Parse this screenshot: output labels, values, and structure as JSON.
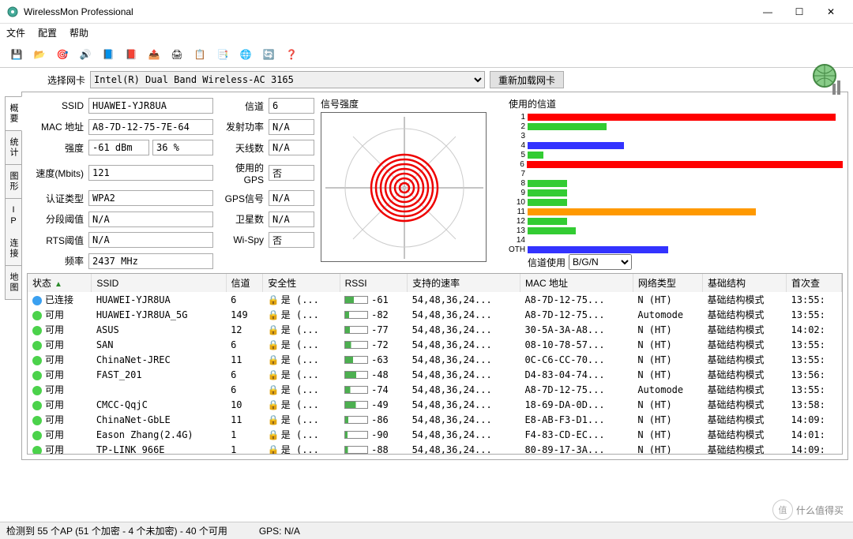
{
  "window": {
    "title": "WirelessMon Professional",
    "min": "—",
    "max": "☐",
    "close": "✕"
  },
  "menu": {
    "file": "文件",
    "config": "配置",
    "help": "帮助"
  },
  "toolbar_icons": [
    {
      "name": "save-icon",
      "glyph": "💾"
    },
    {
      "name": "open-icon",
      "glyph": "📂"
    },
    {
      "name": "target-icon",
      "glyph": "🎯"
    },
    {
      "name": "audio-icon",
      "glyph": "🔊"
    },
    {
      "name": "flag1-icon",
      "glyph": "📘"
    },
    {
      "name": "flag2-icon",
      "glyph": "📕"
    },
    {
      "name": "export-icon",
      "glyph": "📤"
    },
    {
      "name": "print-icon",
      "glyph": "🖨"
    },
    {
      "name": "copy-icon",
      "glyph": "📋"
    },
    {
      "name": "list-icon",
      "glyph": "📑"
    },
    {
      "name": "info-icon",
      "glyph": "🌐"
    },
    {
      "name": "refresh-icon",
      "glyph": "🔄"
    },
    {
      "name": "help-icon",
      "glyph": "❓"
    }
  ],
  "adapter": {
    "label": "选择网卡",
    "value": "Intel(R) Dual Band Wireless-AC 3165",
    "reload": "重新加载网卡"
  },
  "side_tabs": [
    "概要",
    "统计",
    "图形",
    "IP 连接",
    "地图"
  ],
  "info": {
    "labels": {
      "ssid": "SSID",
      "mac": "MAC 地址",
      "strength": "强度",
      "speed": "速度(Mbits)",
      "auth": "认证类型",
      "frag": "分段阈值",
      "rts": "RTS阈值",
      "freq": "频率",
      "channel": "信道",
      "txpower": "发射功率",
      "antennas": "天线数",
      "gps": "使用的GPS",
      "gpssig": "GPS信号",
      "sats": "卫星数",
      "wispy": "Wi-Spy"
    },
    "ssid": "HUAWEI-YJR8UA",
    "mac": "A8-7D-12-75-7E-64",
    "strength_dbm": "-61 dBm",
    "strength_pct": "36 %",
    "speed": "121",
    "auth": "WPA2",
    "frag": "N/A",
    "rts": "N/A",
    "freq": "2437 MHz",
    "channel": "6",
    "txpower": "N/A",
    "antennas": "N/A",
    "gps": "否",
    "gpssig": "N/A",
    "sats": "N/A",
    "wispy": "否"
  },
  "signal_section": {
    "title": "信号强度"
  },
  "channel_section": {
    "title": "使用的信道",
    "use_label": "信道使用",
    "select_value": "B/G/N"
  },
  "chart_data": {
    "type": "bar",
    "title": "使用的信道",
    "xlabel": "",
    "ylabel": "",
    "categories": [
      "1",
      "2",
      "3",
      "4",
      "5",
      "6",
      "7",
      "8",
      "9",
      "10",
      "11",
      "12",
      "13",
      "14",
      "OTH"
    ],
    "values": [
      350,
      90,
      0,
      110,
      18,
      380,
      0,
      45,
      45,
      45,
      260,
      45,
      55,
      0,
      160
    ],
    "colors": [
      "#f00",
      "#3c3",
      "#f00",
      "#33f",
      "#3c3",
      "#f00",
      "#f00",
      "#3c3",
      "#3c3",
      "#3c3",
      "#f90",
      "#3c3",
      "#3c3",
      "#f00",
      "#33f"
    ]
  },
  "grid": {
    "headers": {
      "status": "状态",
      "ssid": "SSID",
      "channel": "信道",
      "security": "安全性",
      "rssi": "RSSI",
      "rates": "支持的速率",
      "mac": "MAC 地址",
      "nettype": "网络类型",
      "infra": "基础结构",
      "first": "首次查"
    },
    "rows": [
      {
        "status": "已连接",
        "dot": "#3aa0f0",
        "ssid": "HUAWEI-YJR8UA",
        "ch": "6",
        "sec": "是 (...",
        "rssi": -61,
        "pct": 40,
        "rates": "54,48,36,24...",
        "mac": "A8-7D-12-75...",
        "net": "N (HT)",
        "infra": "基础结构模式",
        "first": "13:55:"
      },
      {
        "status": "可用",
        "dot": "#4bd24b",
        "ssid": "HUAWEI-YJR8UA_5G",
        "ch": "149",
        "sec": "是 (...",
        "rssi": -82,
        "pct": 18,
        "rates": "54,48,36,24...",
        "mac": "A8-7D-12-75...",
        "net": "Automode",
        "infra": "基础结构模式",
        "first": "13:55:"
      },
      {
        "status": "可用",
        "dot": "#4bd24b",
        "ssid": "ASUS",
        "ch": "12",
        "sec": "是 (...",
        "rssi": -77,
        "pct": 22,
        "rates": "54,48,36,24...",
        "mac": "30-5A-3A-A8...",
        "net": "N (HT)",
        "infra": "基础结构模式",
        "first": "14:02:"
      },
      {
        "status": "可用",
        "dot": "#4bd24b",
        "ssid": "SAN",
        "ch": "6",
        "sec": "是 (...",
        "rssi": -72,
        "pct": 26,
        "rates": "54,48,36,24...",
        "mac": "08-10-78-57...",
        "net": "N (HT)",
        "infra": "基础结构模式",
        "first": "13:55:"
      },
      {
        "status": "可用",
        "dot": "#4bd24b",
        "ssid": "ChinaNet-JREC",
        "ch": "11",
        "sec": "是 (...",
        "rssi": -63,
        "pct": 36,
        "rates": "54,48,36,24...",
        "mac": "0C-C6-CC-70...",
        "net": "N (HT)",
        "infra": "基础结构模式",
        "first": "13:55:"
      },
      {
        "status": "可用",
        "dot": "#4bd24b",
        "ssid": "FAST_201",
        "ch": "6",
        "sec": "是 (...",
        "rssi": -48,
        "pct": 50,
        "rates": "54,48,36,24...",
        "mac": "D4-83-04-74...",
        "net": "N (HT)",
        "infra": "基础结构模式",
        "first": "13:56:"
      },
      {
        "status": "可用",
        "dot": "#4bd24b",
        "ssid": "",
        "ch": "6",
        "sec": "是 (...",
        "rssi": -74,
        "pct": 24,
        "rates": "54,48,36,24...",
        "mac": "A8-7D-12-75...",
        "net": "Automode",
        "infra": "基础结构模式",
        "first": "13:55:"
      },
      {
        "status": "可用",
        "dot": "#4bd24b",
        "ssid": "CMCC-QqjC",
        "ch": "10",
        "sec": "是 (...",
        "rssi": -49,
        "pct": 48,
        "rates": "54,48,36,24...",
        "mac": "18-69-DA-0D...",
        "net": "N (HT)",
        "infra": "基础结构模式",
        "first": "13:58:"
      },
      {
        "status": "可用",
        "dot": "#4bd24b",
        "ssid": "ChinaNet-GbLE",
        "ch": "11",
        "sec": "是 (...",
        "rssi": -86,
        "pct": 14,
        "rates": "54,48,36,24...",
        "mac": "E8-AB-F3-D1...",
        "net": "N (HT)",
        "infra": "基础结构模式",
        "first": "14:09:"
      },
      {
        "status": "可用",
        "dot": "#4bd24b",
        "ssid": "Eason Zhang(2.4G)",
        "ch": "1",
        "sec": "是 (...",
        "rssi": -90,
        "pct": 10,
        "rates": "54,48,36,24...",
        "mac": "F4-83-CD-EC...",
        "net": "N (HT)",
        "infra": "基础结构模式",
        "first": "14:01:"
      },
      {
        "status": "可用",
        "dot": "#4bd24b",
        "ssid": "TP-LINK_966E",
        "ch": "1",
        "sec": "是 (...",
        "rssi": -88,
        "pct": 12,
        "rates": "54,48,36,24...",
        "mac": "80-89-17-3A...",
        "net": "N (HT)",
        "infra": "基础结构模式",
        "first": "14:09:"
      }
    ]
  },
  "statusbar": {
    "detected": "检测到 55 个AP (51 个加密 - 4 个未加密) - 40 个可用",
    "gps": "GPS: N/A"
  },
  "watermark": {
    "brand": "值",
    "text": "什么值得买"
  }
}
